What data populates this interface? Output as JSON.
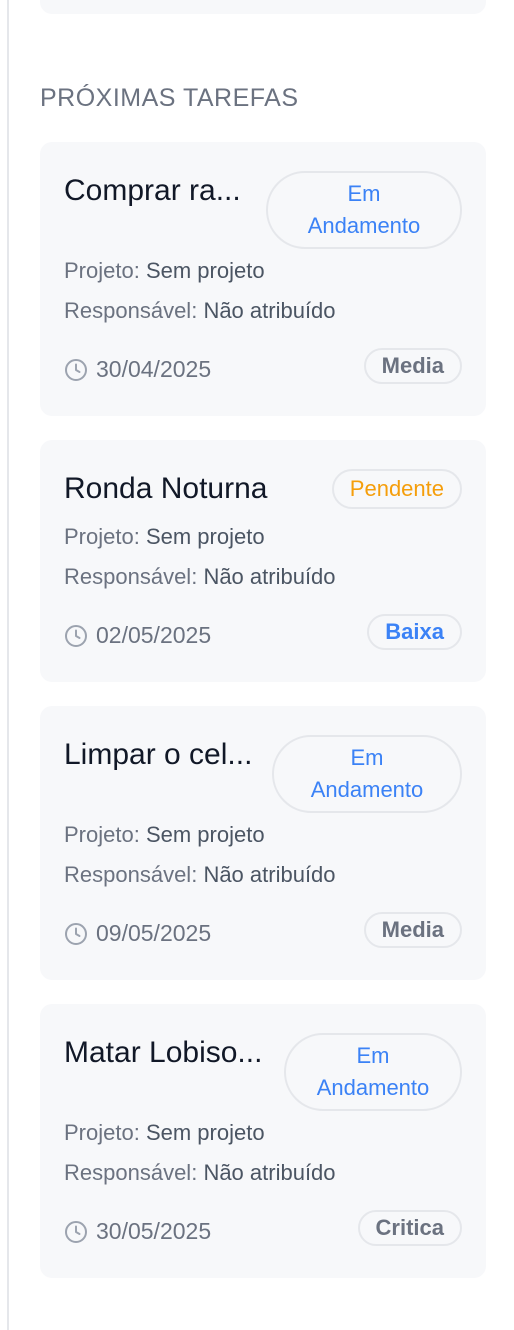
{
  "section": {
    "title": "PRÓXIMAS TAREFAS"
  },
  "labels": {
    "project": "Projeto:",
    "assignee": "Responsável:"
  },
  "tasks": [
    {
      "title": "Comprar ra...",
      "status": "Em Andamento",
      "status_line1": "Em",
      "status_line2": "Andamento",
      "project": "Sem projeto",
      "assignee": "Não atribuído",
      "date": "30/04/2025",
      "priority": "Media"
    },
    {
      "title": "Ronda Noturna",
      "status": "Pendente",
      "project": "Sem projeto",
      "assignee": "Não atribuído",
      "date": "02/05/2025",
      "priority": "Baixa"
    },
    {
      "title": "Limpar o cel...",
      "status": "Em Andamento",
      "status_line1": "Em",
      "status_line2": "Andamento",
      "project": "Sem projeto",
      "assignee": "Não atribuído",
      "date": "09/05/2025",
      "priority": "Media"
    },
    {
      "title": "Matar Lobiso...",
      "status": "Em Andamento",
      "status_line1": "Em",
      "status_line2": "Andamento",
      "project": "Sem projeto",
      "assignee": "Não atribuído",
      "date": "30/05/2025",
      "priority": "Critica"
    }
  ],
  "colors": {
    "status_in_progress": "#3b82f6",
    "status_pending": "#f59e0b",
    "priority_low": "#3b82f6",
    "priority_default": "#6b7280"
  },
  "icons": {
    "date": "clock-icon"
  }
}
